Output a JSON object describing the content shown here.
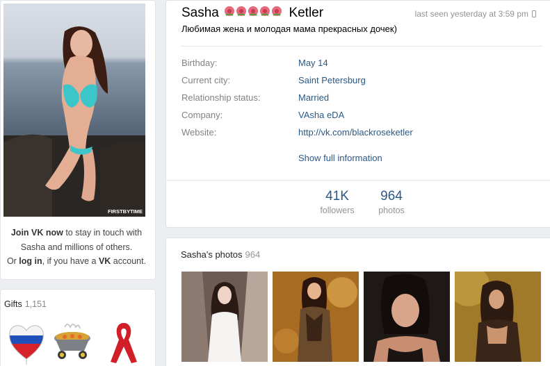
{
  "profile": {
    "first_name": "Sasha",
    "last_name": "Ketler",
    "last_seen": "last seen yesterday at 3:59 pm",
    "status": "Любимая жена и молодая мама прекрасных дочек)",
    "info": [
      {
        "label": "Birthday:",
        "value": "May 14"
      },
      {
        "label": "Current city:",
        "value": "Saint Petersburg"
      },
      {
        "label": "Relationship status:",
        "value": "Married"
      },
      {
        "label": "Company:",
        "value": "VAsha eDA"
      },
      {
        "label": "Website:",
        "value": "http://vk.com/blackroseketler"
      }
    ],
    "show_full": "Show full information",
    "counters": [
      {
        "num": "41K",
        "label": "followers"
      },
      {
        "num": "964",
        "label": "photos"
      }
    ]
  },
  "avatar": {
    "watermark": "FIRSTBYTIME"
  },
  "join": {
    "p1": "Join VK now",
    "p2": " to stay in touch with",
    "p3": "Sasha and millions of others.",
    "p4": "Or ",
    "p5": "log in",
    "p6": ", if you have a ",
    "p7": "VK",
    "p8": " account."
  },
  "gifts": {
    "title": "Gifts",
    "count": "1,151",
    "items": [
      "heart-flag-gift-icon",
      "grill-gift-icon",
      "ribbon-gift-icon"
    ]
  },
  "photos": {
    "title": "Sasha's photos",
    "count": "964"
  },
  "colors": {
    "link": "#2a5885",
    "muted": "#939393",
    "background": "#edeef0"
  }
}
